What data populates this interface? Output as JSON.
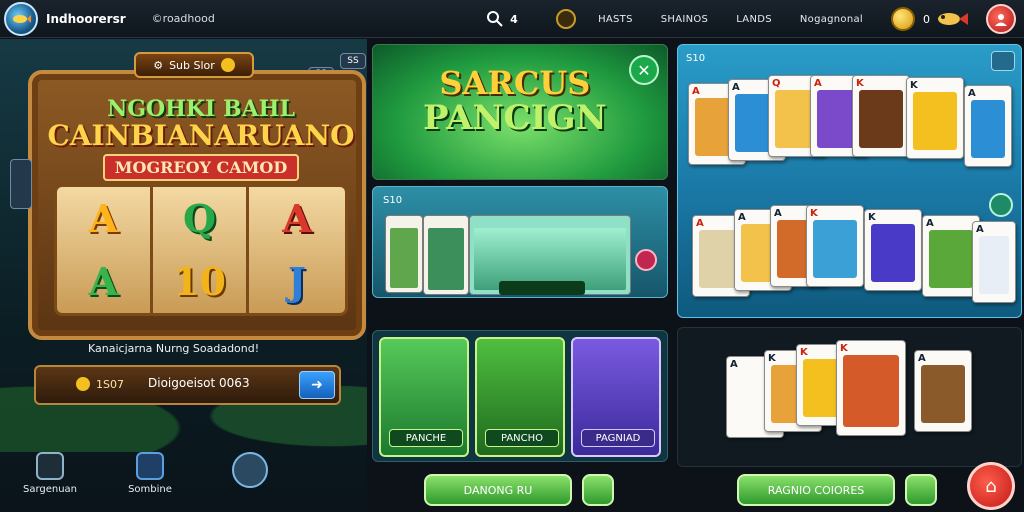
{
  "header": {
    "app_title": "Indhoorersr",
    "subtitle": "©roadhood",
    "search_count": "4",
    "links": [
      "HASTS",
      "SHAINOS",
      "LANDS",
      "Nogagnonal"
    ],
    "coins": "0"
  },
  "left": {
    "badge": "Sub Slor",
    "side_top": "SS",
    "side_top2": "SS",
    "machine": {
      "line1": "NGOHKI BAHL",
      "line2": "CAINBIANARUANO",
      "line3": "MOGREOY CAMOD"
    },
    "reels": [
      "A",
      "Q",
      "A",
      "A",
      "10",
      "J"
    ],
    "caption": "Kanaicjarna Nurng Soadadond!",
    "input_prefix": "1S07",
    "input_value": "Dioigoeisot 0063",
    "nav": [
      {
        "label": "Sargenuan"
      },
      {
        "label": "Sombine"
      },
      {
        "label": ""
      }
    ]
  },
  "middle": {
    "promo": {
      "line1": "SARCUS",
      "line2": "PANCIGN"
    },
    "section_tag": "S10",
    "fish_label": "",
    "cards": [
      {
        "label": "PANCHE"
      },
      {
        "label": "PANCHO"
      },
      {
        "label": "PAGNIAD"
      }
    ],
    "button": "DANONG RU"
  },
  "right": {
    "section_tag": "S10",
    "button": "RAGNIO COIORES"
  },
  "colors": {
    "accent_green": "#2f9a2e",
    "accent_red": "#c11a18",
    "gold": "#f3c01f"
  }
}
